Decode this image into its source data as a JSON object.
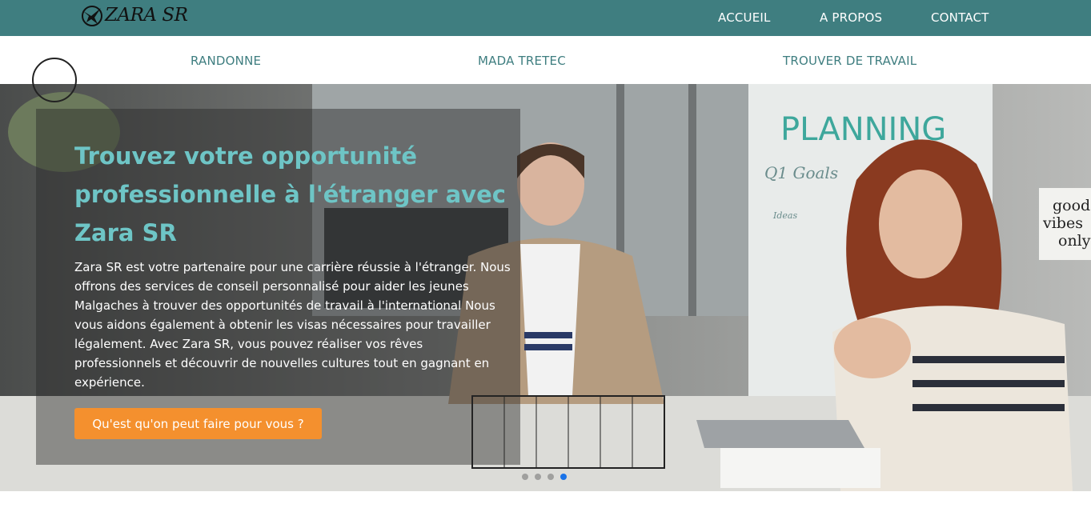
{
  "brand": {
    "logo_text": "ZARA SR"
  },
  "top_nav": {
    "items": [
      {
        "label": "ACCUEIL"
      },
      {
        "label": "A PROPOS"
      },
      {
        "label": "CONTACT"
      }
    ]
  },
  "sub_nav": {
    "items": [
      {
        "label": "RANDONNE"
      },
      {
        "label": "MADA TRETEC"
      },
      {
        "label": "TROUVER DE TRAVAIL"
      }
    ]
  },
  "hero": {
    "title": "Trouvez votre opportunité professionnelle à l'étranger avec Zara SR",
    "description": "Zara SR est votre partenaire pour une carrière réussie à l'étranger. Nous offrons des services de conseil personnalisé pour aider les jeunes Malgaches à trouver des opportunités de travail à l'international Nous vous aidons également à obtenir les visas nécessaires pour travailler légalement. Avec Zara SR, vous pouvez réaliser vos rêves professionnels et découvrir de nouvelles cultures tout en gagnant en expérience.",
    "cta_label": "Qu'est qu'on peut faire pour vous ?",
    "slides_total": 4,
    "slide_active": 4
  },
  "photo_text": {
    "board_title": "PLANNING",
    "board_line": "Q1 Goals",
    "board_note": "Ideas",
    "poster_line1": "good",
    "poster_line2": "vibes",
    "poster_line3": "only"
  },
  "colors": {
    "topbar": "#3f7e80",
    "accent_teal": "#6ec5c6",
    "cta": "#f4902e",
    "active_dot": "#1a73e8"
  }
}
